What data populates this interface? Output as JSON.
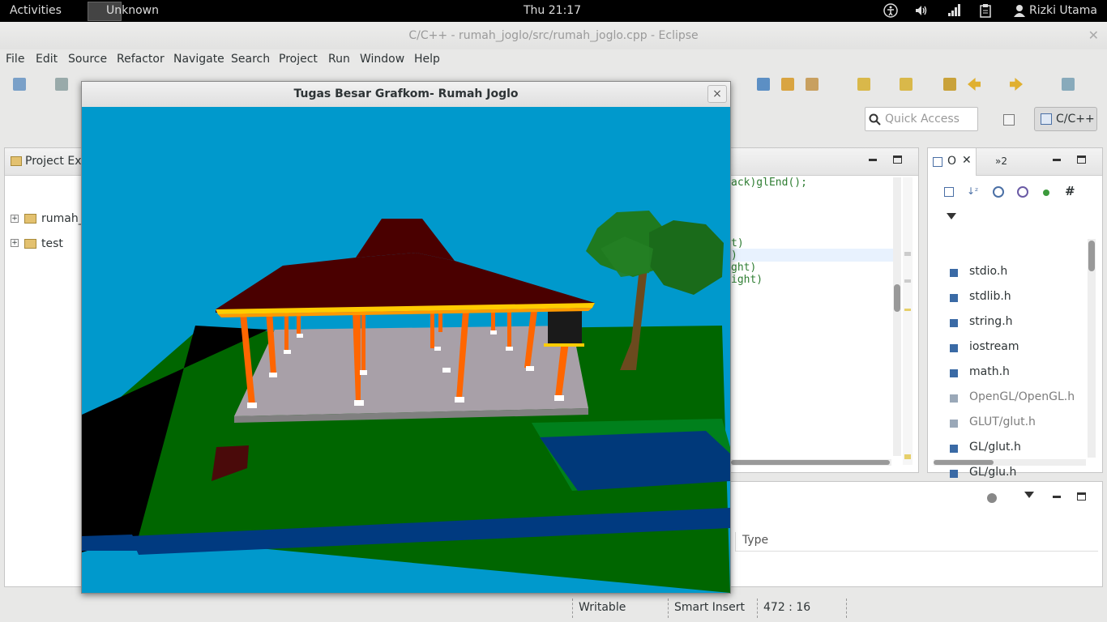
{
  "topbar": {
    "activities": "Activities",
    "app_name": "Unknown",
    "clock": "Thu 21:17",
    "user": "Rizki Utama"
  },
  "window": {
    "title": "C/C++ - rumah_joglo/src/rumah_joglo.cpp - Eclipse"
  },
  "menu": [
    "File",
    "Edit",
    "Source",
    "Refactor",
    "Navigate",
    "Search",
    "Project",
    "Run",
    "Window",
    "Help"
  ],
  "quick_access": {
    "placeholder": "Quick Access"
  },
  "perspective": {
    "label": "C/C++"
  },
  "project_explorer": {
    "title": "Project Exp",
    "items": [
      {
        "label": "rumah_"
      },
      {
        "label": "test"
      }
    ]
  },
  "editor": {
    "lines": [
      "ack)glEnd();",
      "t)",
      ")",
      "ght)",
      "ight)"
    ]
  },
  "outline": {
    "tab_label": "O",
    "tab2_label": "»2",
    "items": [
      {
        "label": "stdio.h",
        "dim": false
      },
      {
        "label": "stdlib.h",
        "dim": false
      },
      {
        "label": "string.h",
        "dim": false
      },
      {
        "label": "iostream",
        "dim": false
      },
      {
        "label": "math.h",
        "dim": false
      },
      {
        "label": "OpenGL/OpenGL.h",
        "dim": true
      },
      {
        "label": "GLUT/glut.h",
        "dim": true
      },
      {
        "label": "GL/glut.h",
        "dim": false
      },
      {
        "label": "GL/glu.h",
        "dim": false
      }
    ]
  },
  "bottom_panel": {
    "column_type": "Type"
  },
  "status": {
    "writable": "Writable",
    "insert_mode": "Smart Insert",
    "position": "472 : 16"
  },
  "glut_window": {
    "title": "Tugas Besar Grafkom- Rumah Joglo",
    "close": "×"
  },
  "colors": {
    "sky": "#0099cc",
    "grass": "#006600",
    "roof": "#4a0000",
    "pillars": "#ff6600",
    "floor": "#a8a0a8",
    "water": "#003a80",
    "tree_foliage": "#1f7a1f",
    "trunk": "#6b4a1e"
  }
}
